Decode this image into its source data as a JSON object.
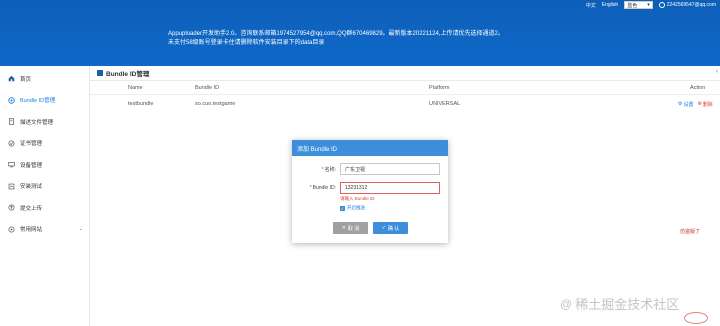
{
  "header": {
    "lang_cn": "中文",
    "lang_en": "English",
    "theme_select": "蓝色",
    "user": "2242569547@qq.com",
    "notice_line1": "Appuploader开发助手2.0。咨询联系邮箱1974527954@qq.com,QQ群670469829。最新版本20221124,上传请优先选择通道2。",
    "notice_line2": "未支付58级账号登录卡住请删除软件安装目录下的data目录"
  },
  "sidebar": {
    "items": [
      {
        "label": "首页",
        "icon": "home-icon"
      },
      {
        "label": "Bundle ID管理",
        "icon": "bundle-icon"
      },
      {
        "label": "描述文件管理",
        "icon": "profile-icon"
      },
      {
        "label": "证书管理",
        "icon": "cert-icon"
      },
      {
        "label": "设备管理",
        "icon": "device-icon"
      },
      {
        "label": "安装测试",
        "icon": "install-icon"
      },
      {
        "label": "提交上传",
        "icon": "upload-icon"
      },
      {
        "label": "常用网站",
        "icon": "web-icon"
      }
    ]
  },
  "main": {
    "title": "Bundle ID管理",
    "table": {
      "headers": [
        "Name",
        "Bundle ID",
        "Platform",
        "Action"
      ],
      "rows": [
        {
          "name": "testbundle",
          "bundle_id": "so.cuo.testgame",
          "platform": "UNIVERSAL",
          "edit": "设置",
          "delete": "删除"
        }
      ]
    }
  },
  "dialog": {
    "title": "添加 Bundle ID",
    "name_label": "名称:",
    "name_value": "广东卫视",
    "bid_label": "Bundle ID:",
    "bid_value": "13231312",
    "error": "请输入 Bundle ID",
    "checkbox_label": "开启推送",
    "cancel": "取 消",
    "ok": "确 认"
  },
  "overlay": {
    "stamp_text": "仿盗版了",
    "watermark": "稀土掘金技术社区"
  },
  "colors": {
    "header_bg": "#0f69c9",
    "accent": "#3d8fdc",
    "error": "#e04040"
  }
}
